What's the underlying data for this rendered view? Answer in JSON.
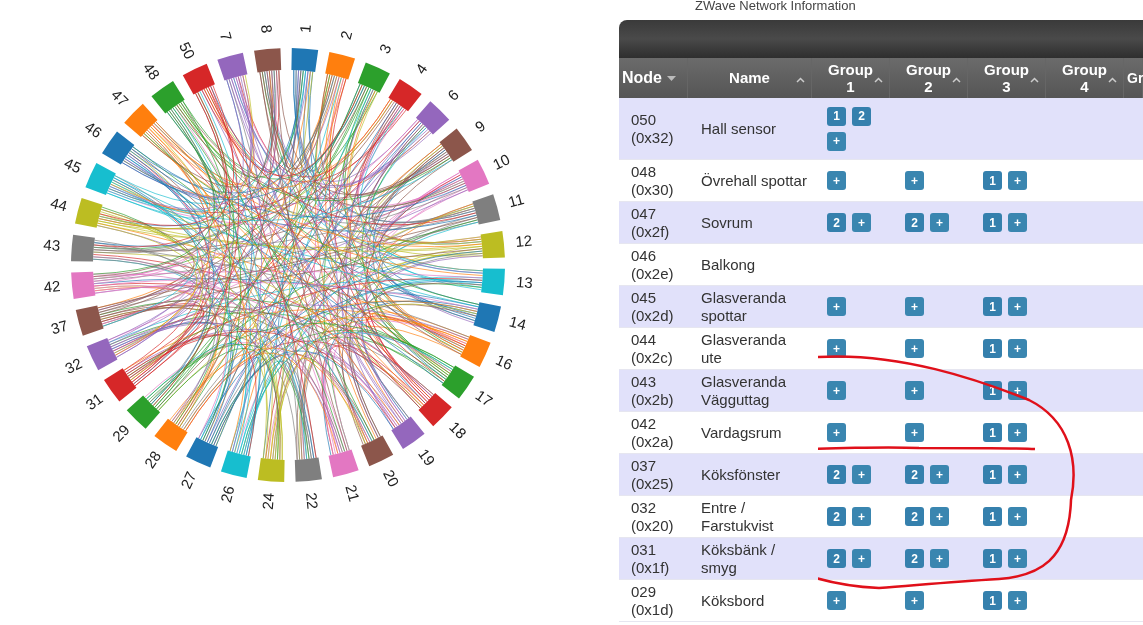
{
  "chord_diagram": {
    "nodes": [
      {
        "label": "1",
        "color": "#1f77b4"
      },
      {
        "label": "2",
        "color": "#ff7f0e"
      },
      {
        "label": "3",
        "color": "#2ca02c"
      },
      {
        "label": "4",
        "color": "#d62728"
      },
      {
        "label": "6",
        "color": "#9467bd"
      },
      {
        "label": "9",
        "color": "#8c564b"
      },
      {
        "label": "10",
        "color": "#e377c2"
      },
      {
        "label": "11",
        "color": "#7f7f7f"
      },
      {
        "label": "12",
        "color": "#bcbd22"
      },
      {
        "label": "13",
        "color": "#17becf"
      },
      {
        "label": "14",
        "color": "#1f77b4"
      },
      {
        "label": "16",
        "color": "#ff7f0e"
      },
      {
        "label": "17",
        "color": "#2ca02c"
      },
      {
        "label": "18",
        "color": "#d62728"
      },
      {
        "label": "19",
        "color": "#9467bd"
      },
      {
        "label": "20",
        "color": "#8c564b"
      },
      {
        "label": "21",
        "color": "#e377c2"
      },
      {
        "label": "22",
        "color": "#7f7f7f"
      },
      {
        "label": "24",
        "color": "#bcbd22"
      },
      {
        "label": "26",
        "color": "#17becf"
      },
      {
        "label": "27",
        "color": "#1f77b4"
      },
      {
        "label": "28",
        "color": "#ff7f0e"
      },
      {
        "label": "29",
        "color": "#2ca02c"
      },
      {
        "label": "31",
        "color": "#d62728"
      },
      {
        "label": "32",
        "color": "#9467bd"
      },
      {
        "label": "37",
        "color": "#8c564b"
      },
      {
        "label": "42",
        "color": "#e377c2"
      },
      {
        "label": "43",
        "color": "#7f7f7f"
      },
      {
        "label": "44",
        "color": "#bcbd22"
      },
      {
        "label": "45",
        "color": "#17becf"
      },
      {
        "label": "46",
        "color": "#1f77b4"
      },
      {
        "label": "47",
        "color": "#ff7f0e"
      },
      {
        "label": "48",
        "color": "#2ca02c"
      },
      {
        "label": "50",
        "color": "#d62728"
      },
      {
        "label": "7",
        "color": "#9467bd"
      },
      {
        "label": "8",
        "color": "#8c564b"
      }
    ]
  },
  "panel": {
    "title": "ZWave Network Information"
  },
  "table": {
    "columns": [
      {
        "label": "Node",
        "sorted": true
      },
      {
        "label": "Name",
        "sorted": false
      },
      {
        "label": "Group 1",
        "sorted": false
      },
      {
        "label": "Group 2",
        "sorted": false
      },
      {
        "label": "Group 3",
        "sorted": false
      },
      {
        "label": "Group 4",
        "sorted": false
      },
      {
        "label": "Gr"
      }
    ],
    "rows": [
      {
        "node": "050 (0x32)",
        "name": "Hall sensor",
        "group_1": [
          {
            "label": "1",
            "kind": "member"
          },
          {
            "label": "2",
            "kind": "member"
          },
          {
            "label": "+",
            "kind": "add"
          }
        ]
      },
      {
        "node": "048 (0x30)",
        "name": "Övrehall spottar",
        "group_1": [
          {
            "label": "+",
            "kind": "add"
          }
        ],
        "group_2": [
          {
            "label": "+",
            "kind": "add"
          }
        ],
        "group_3": [
          {
            "label": "1",
            "kind": "member"
          },
          {
            "label": "+",
            "kind": "add"
          }
        ]
      },
      {
        "node": "047 (0x2f)",
        "name": "Sovrum",
        "group_1": [
          {
            "label": "2",
            "kind": "member"
          },
          {
            "label": "+",
            "kind": "add"
          }
        ],
        "group_2": [
          {
            "label": "2",
            "kind": "member"
          },
          {
            "label": "+",
            "kind": "add"
          }
        ],
        "group_3": [
          {
            "label": "1",
            "kind": "member"
          },
          {
            "label": "+",
            "kind": "add"
          }
        ]
      },
      {
        "node": "046 (0x2e)",
        "name": "Balkong"
      },
      {
        "node": "045 (0x2d)",
        "name": "Glasveranda spottar",
        "group_1": [
          {
            "label": "+",
            "kind": "add"
          }
        ],
        "group_2": [
          {
            "label": "+",
            "kind": "add"
          }
        ],
        "group_3": [
          {
            "label": "1",
            "kind": "member"
          },
          {
            "label": "+",
            "kind": "add"
          }
        ]
      },
      {
        "node": "044 (0x2c)",
        "name": "Glasveranda ute",
        "group_1": [
          {
            "label": "+",
            "kind": "add"
          }
        ],
        "group_2": [
          {
            "label": "+",
            "kind": "add"
          }
        ],
        "group_3": [
          {
            "label": "1",
            "kind": "member"
          },
          {
            "label": "+",
            "kind": "add"
          }
        ]
      },
      {
        "node": "043 (0x2b)",
        "name": "Glasveranda Vägguttag",
        "group_1": [
          {
            "label": "+",
            "kind": "add"
          }
        ],
        "group_2": [
          {
            "label": "+",
            "kind": "add"
          }
        ],
        "group_3": [
          {
            "label": "1",
            "kind": "member"
          },
          {
            "label": "+",
            "kind": "add"
          }
        ]
      },
      {
        "node": "042 (0x2a)",
        "name": "Vardagsrum",
        "group_1": [
          {
            "label": "+",
            "kind": "add"
          }
        ],
        "group_2": [
          {
            "label": "+",
            "kind": "add"
          }
        ],
        "group_3": [
          {
            "label": "1",
            "kind": "member"
          },
          {
            "label": "+",
            "kind": "add"
          }
        ]
      },
      {
        "node": "037 (0x25)",
        "name": "Köksfönster",
        "group_1": [
          {
            "label": "2",
            "kind": "member"
          },
          {
            "label": "+",
            "kind": "add"
          }
        ],
        "group_2": [
          {
            "label": "2",
            "kind": "member"
          },
          {
            "label": "+",
            "kind": "add"
          }
        ],
        "group_3": [
          {
            "label": "1",
            "kind": "member"
          },
          {
            "label": "+",
            "kind": "add"
          }
        ]
      },
      {
        "node": "032 (0x20)",
        "name": "Entre / Farstukvist",
        "group_1": [
          {
            "label": "2",
            "kind": "member"
          },
          {
            "label": "+",
            "kind": "add"
          }
        ],
        "group_2": [
          {
            "label": "2",
            "kind": "member"
          },
          {
            "label": "+",
            "kind": "add"
          }
        ],
        "group_3": [
          {
            "label": "1",
            "kind": "member"
          },
          {
            "label": "+",
            "kind": "add"
          }
        ]
      },
      {
        "node": "031 (0x1f)",
        "name": "Köksbänk / smyg",
        "group_1": [
          {
            "label": "2",
            "kind": "member"
          },
          {
            "label": "+",
            "kind": "add"
          }
        ],
        "group_2": [
          {
            "label": "2",
            "kind": "member"
          },
          {
            "label": "+",
            "kind": "add"
          }
        ],
        "group_3": [
          {
            "label": "1",
            "kind": "member"
          },
          {
            "label": "+",
            "kind": "add"
          }
        ]
      },
      {
        "node": "029 (0x1d)",
        "name": "Köksbord",
        "group_1": [
          {
            "label": "+",
            "kind": "add"
          }
        ],
        "group_2": [
          {
            "label": "+",
            "kind": "add"
          }
        ],
        "group_3": [
          {
            "label": "1",
            "kind": "member"
          },
          {
            "label": "+",
            "kind": "add"
          }
        ]
      }
    ]
  }
}
